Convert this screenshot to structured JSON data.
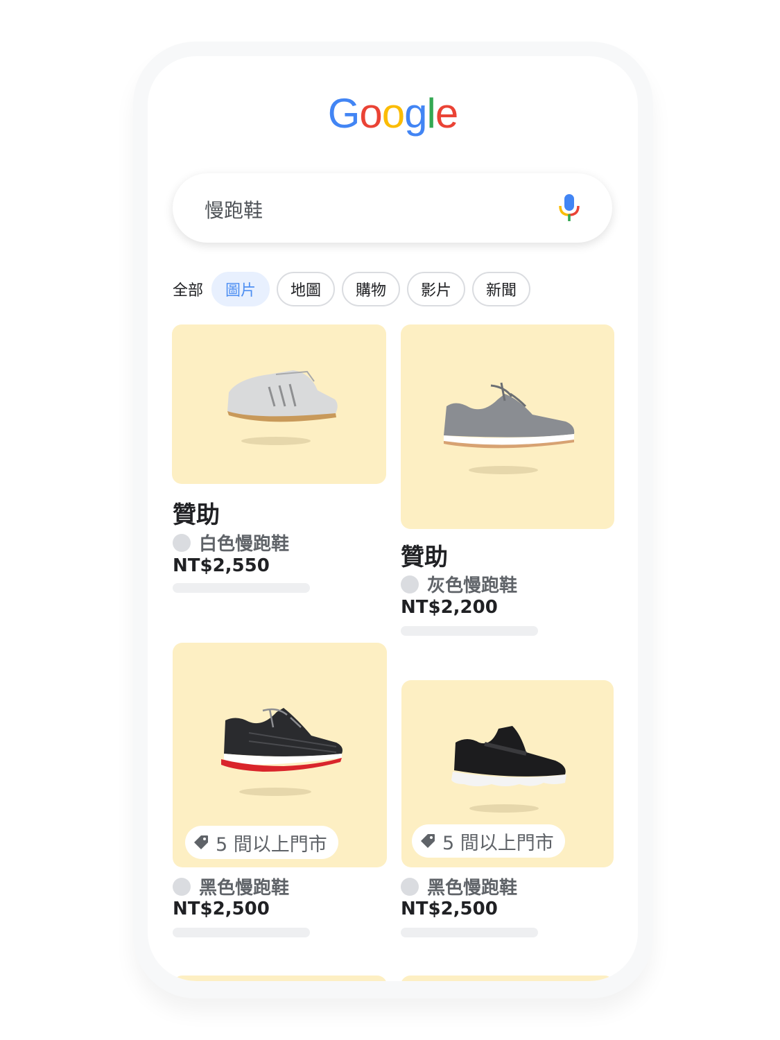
{
  "app": {
    "logo": [
      "G",
      "o",
      "o",
      "g",
      "l",
      "e"
    ],
    "logo_colors": [
      "#4285F4",
      "#EA4335",
      "#FBBC05",
      "#4285F4",
      "#34A853",
      "#EA4335"
    ]
  },
  "search": {
    "query": "慢跑鞋",
    "mic_icon": "microphone-icon"
  },
  "tabs": {
    "all_label": "全部",
    "chips": [
      "圖片",
      "地圖",
      "購物",
      "影片",
      "新聞"
    ],
    "active_chip": "圖片"
  },
  "products": [
    {
      "sponsored": "贊助",
      "store": "白色慢跑鞋",
      "price": "NT$2,550",
      "shoe": "white-running-shoe"
    },
    {
      "sponsored": "贊助",
      "store": "灰色慢跑鞋",
      "price": "NT$2,200",
      "shoe": "grey-running-shoe"
    },
    {
      "badge": "5 間以上門市",
      "store": "黑色慢跑鞋",
      "price": "NT$2,500",
      "shoe": "black-red-running-shoe"
    },
    {
      "badge": "5 間以上門市",
      "store": "黑色慢跑鞋",
      "price": "NT$2,500",
      "shoe": "black-slip-on-shoe"
    }
  ],
  "colors": {
    "card_background": "#fdefc3",
    "chip_active_bg": "#e8f0fe",
    "chip_active_text": "#4e8ff2"
  }
}
